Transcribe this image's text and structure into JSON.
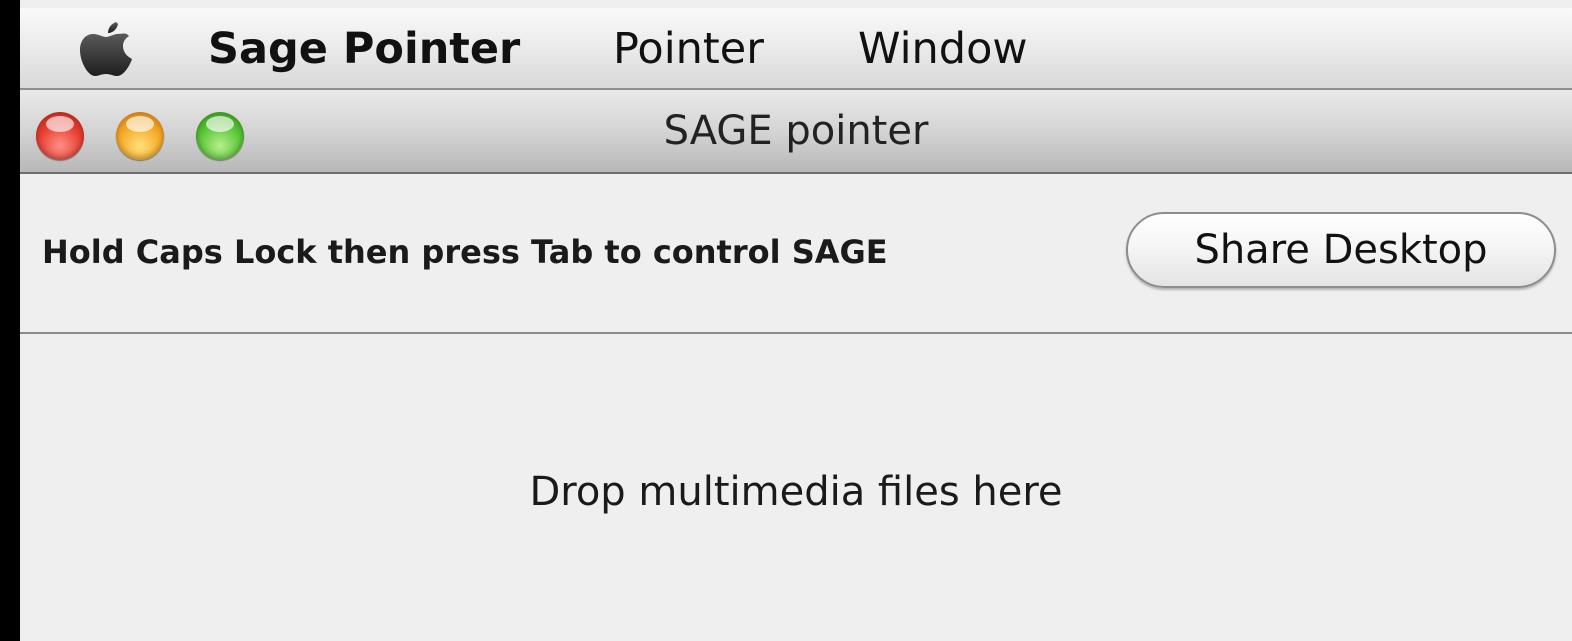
{
  "menubar": {
    "apple_icon": "apple-logo-icon",
    "app_name": "Sage Pointer",
    "items": [
      "Pointer",
      "Window"
    ]
  },
  "window": {
    "title": "SAGE pointer",
    "controls": [
      "close-icon",
      "minimize-icon",
      "zoom-icon"
    ]
  },
  "toolbar": {
    "hint": "Hold Caps Lock then press Tab to control SAGE",
    "share_label": "Share Desktop"
  },
  "dropzone": {
    "label": "Drop multimedia files here"
  },
  "colors": {
    "close": "#e53c2f",
    "minimize": "#f5a623",
    "zoom": "#55c234",
    "window_bg": "#efefef"
  }
}
